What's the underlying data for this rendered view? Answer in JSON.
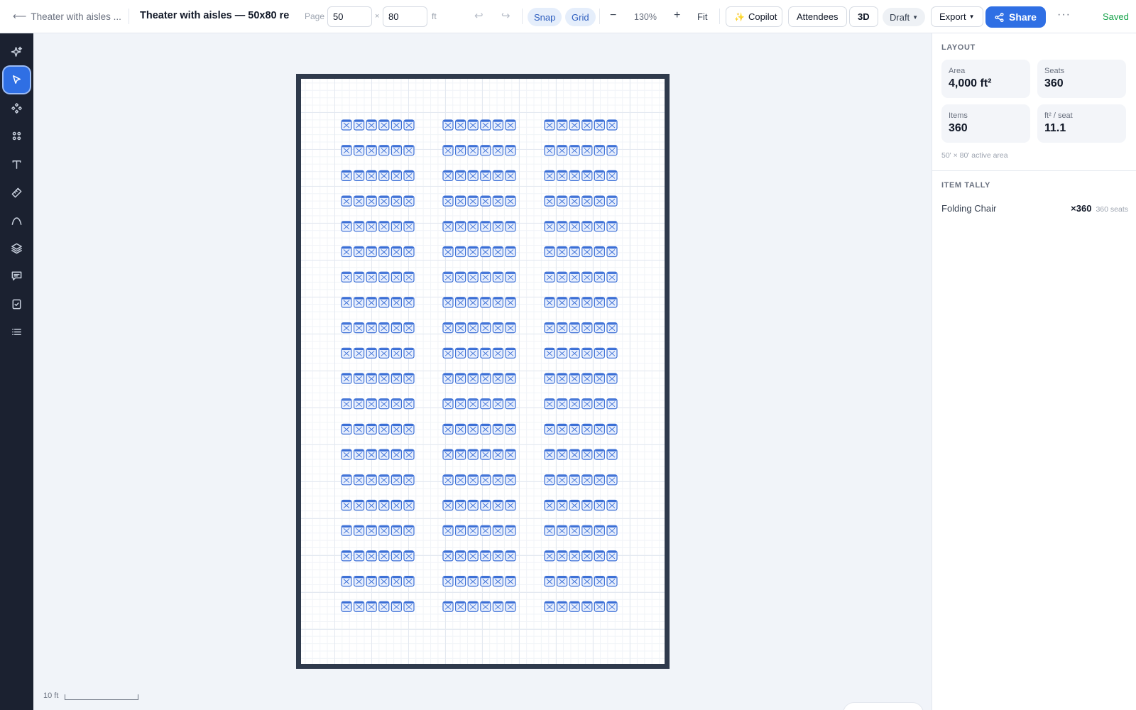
{
  "header": {
    "back_label": "Theater with aisles ...",
    "title": "Theater with aisles — 50x80 re",
    "page_label": "Page",
    "page_width": "50",
    "page_height": "80",
    "times": "×",
    "unit": "ft",
    "snap_label": "Snap",
    "grid_label": "Grid",
    "zoom_out": "−",
    "zoom_value": "130%",
    "zoom_in": "+",
    "fit_label": "Fit",
    "copilot_label": "Copilot",
    "attendees_label": "Attendees",
    "view3d_label": "3D",
    "status_label": "Draft",
    "export_label": "Export",
    "share_label": "Share",
    "saved_label": "Saved"
  },
  "toolbar": {
    "tools": [
      {
        "name": "ai",
        "icon": "sparkle-icon"
      },
      {
        "name": "select",
        "icon": "cursor-icon",
        "active": true
      },
      {
        "name": "components",
        "icon": "component-icon"
      },
      {
        "name": "group",
        "icon": "grid-dots-icon"
      },
      {
        "name": "text",
        "icon": "text-icon"
      },
      {
        "name": "measure",
        "icon": "ruler-icon"
      },
      {
        "name": "path",
        "icon": "curve-icon"
      },
      {
        "name": "layers",
        "icon": "layers-icon"
      },
      {
        "name": "comments",
        "icon": "comment-icon"
      },
      {
        "name": "checklist",
        "icon": "checklist-icon"
      },
      {
        "name": "list",
        "icon": "list-icon"
      }
    ]
  },
  "canvas": {
    "chair_item": "Folding Chair",
    "blocks": 3,
    "rows": 20,
    "seats_per_row": 6,
    "scale_label": "10 ft",
    "count_items": "360",
    "count_people": "360"
  },
  "panel": {
    "layout_title": "LAYOUT",
    "stats": {
      "area_label": "Area",
      "area_value": "4,000 ft²",
      "seats_label": "Seats",
      "seats_value": "360",
      "items_label": "Items",
      "items_value": "360",
      "ratio_label": "ft² / seat",
      "ratio_value": "11.1"
    },
    "active_area": "50' × 80' active area",
    "tally_title": "ITEM TALLY",
    "tally": [
      {
        "name": "Folding Chair",
        "count": "×360",
        "seats": "360 seats"
      }
    ]
  },
  "colors": {
    "accent": "#2f6fe4",
    "chair_stroke": "#3b6fd6",
    "chair_fill": "#e8effd",
    "rail_bg": "#1b2130",
    "saved": "#16a34a"
  }
}
